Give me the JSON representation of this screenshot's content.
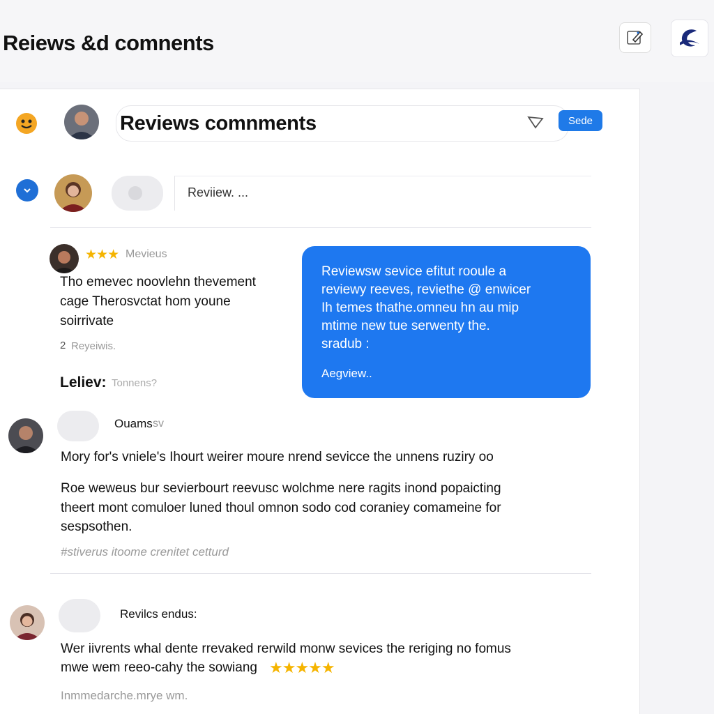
{
  "header": {
    "title": "Reiews &d comnents",
    "edit_icon": "edit-icon",
    "brand_icon": "brand-logo-icon"
  },
  "composer": {
    "search_text": "Reviews comnments",
    "send_label": "Sede",
    "review_placeholder": "Reviiew. ..."
  },
  "featured_review": {
    "stars": "★★★",
    "meta": "Mevieus",
    "lines": [
      "Tho emevec noovlehn thevement",
      "cage Therosvctat hom youne",
      "soirrivate"
    ],
    "count": "2",
    "count_label": "Reyeiwis.",
    "reply_label": "Leliev:",
    "reply_hint": "Tonnens?"
  },
  "highlight_card": {
    "lines": [
      "Reviewsw sevice efitut rooule a",
      "reviewy reeves, reviethe @ enwicer",
      "Ih temes thathe.omneu hn au mip",
      "mtime new tue serwenty the.",
      "sradub :"
    ],
    "link": "Aegview.."
  },
  "comments": [
    {
      "author": "Ouams",
      "author_suffix": "sv",
      "lines": [
        "Mory for's vniele's Ihourt weirer moure nrend sevicce the unnens ruziry oo"
      ],
      "paragraph": [
        "Roe weweus bur sevierbourt reevusc wolchme nere ragits inond popaicting",
        "theert mont comuloer luned thoul omnon sodo cod coraniey comameine for",
        "sespsothen."
      ],
      "footer": "#stiverus itoome crenitet cetturd"
    },
    {
      "author": "Revilcs endus:",
      "lines": [
        "Wer iivrents whal dente rrevaked rerwild monw sevices the reriging no fomus",
        "mwe wem reeo-cahy the sowiang"
      ],
      "stars": "★★★★★",
      "footer": "Inmmedarche.mrye wm."
    }
  ],
  "colors": {
    "accent": "#1f7ae8",
    "card": "#1e78f0",
    "star": "#f5b400"
  }
}
